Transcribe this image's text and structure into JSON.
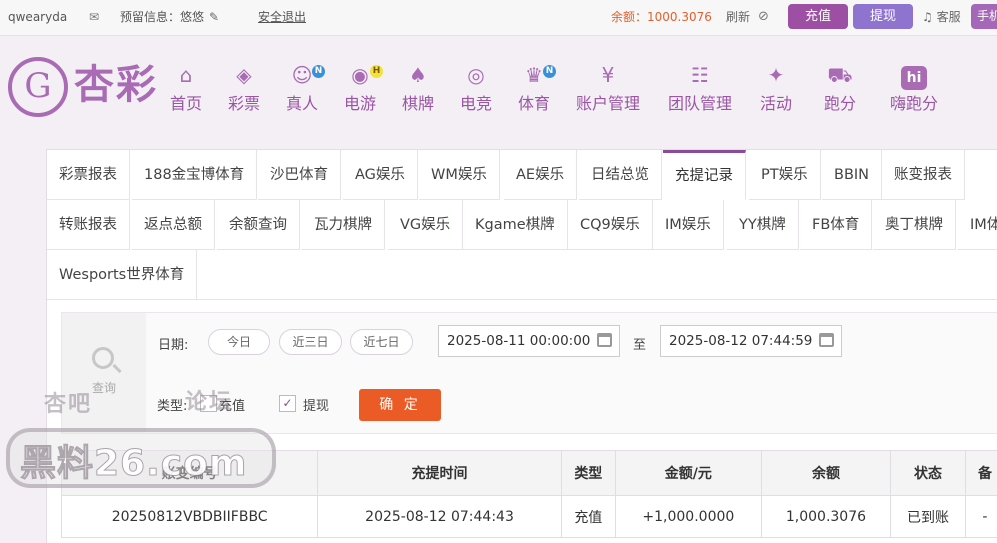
{
  "topbar": {
    "username": "qwearyda",
    "reserved_info": "预留信息：悠悠",
    "logout": "安全退出",
    "balance": "余额：1000.3076",
    "refresh": "刷新",
    "recharge": "充值",
    "withdraw": "提现",
    "service": "客服",
    "mobile": "手机"
  },
  "logo": {
    "mark": "G",
    "text": "杏彩"
  },
  "nav": [
    {
      "label": "首页",
      "icon": "home-icon",
      "glyph": "⌂",
      "badge": ""
    },
    {
      "label": "彩票",
      "icon": "lottery-icon",
      "glyph": "◈",
      "badge": ""
    },
    {
      "label": "真人",
      "icon": "live-dealer-icon",
      "glyph": "☺",
      "badge": "N"
    },
    {
      "label": "电游",
      "icon": "gamepad-icon",
      "glyph": "◉",
      "badge": "H"
    },
    {
      "label": "棋牌",
      "icon": "cards-icon",
      "glyph": "♠",
      "badge": ""
    },
    {
      "label": "电竞",
      "icon": "esports-icon",
      "glyph": "◎",
      "badge": ""
    },
    {
      "label": "体育",
      "icon": "trophy-icon",
      "glyph": "♛",
      "badge": "N"
    },
    {
      "label": "账户管理",
      "icon": "account-icon",
      "glyph": "¥",
      "badge": ""
    },
    {
      "label": "团队管理",
      "icon": "team-icon",
      "glyph": "☷",
      "badge": ""
    },
    {
      "label": "活动",
      "icon": "gift-icon",
      "glyph": "✦",
      "badge": ""
    },
    {
      "label": "跑分",
      "icon": "truck-icon",
      "glyph": "⛟",
      "badge": ""
    },
    {
      "label": "嗨跑分",
      "icon": "hi-icon",
      "glyph": "hi",
      "badge": ""
    }
  ],
  "tabs": [
    "彩票报表",
    "188金宝博体育",
    "沙巴体育",
    "AG娱乐",
    "WM娱乐",
    "AE娱乐",
    "日结总览",
    "充提记录",
    "PT娱乐",
    "BBIN",
    "账变报表",
    "转账报表",
    "返点总额",
    "余额查询",
    "瓦力棋牌",
    "VG娱乐",
    "Kgame棋牌",
    "CQ9娱乐",
    "IM娱乐",
    "YY棋牌",
    "FB体育",
    "奥丁棋牌",
    "IM体",
    "Wesports世界体育"
  ],
  "active_tab": "充提记录",
  "filter": {
    "search_label": "查询",
    "date_label": "日期:",
    "quick": [
      "今日",
      "近三日",
      "近七日"
    ],
    "start": "2025-08-11 00:00:00",
    "to": "至",
    "end": "2025-08-12 07:44:59",
    "type_label": "类型:",
    "types": [
      {
        "label": "充值",
        "checked": false
      },
      {
        "label": "提现",
        "checked": true
      }
    ],
    "confirm": "确 定"
  },
  "table": {
    "headers": [
      "账变编号",
      "充提时间",
      "类型",
      "金额/元",
      "余额",
      "状态",
      "备"
    ],
    "rows": [
      [
        "20250812VBDBIIFBBC",
        "2025-08-12 07:44:43",
        "充值",
        "+1,000.0000",
        "1,000.3076",
        "已到账",
        "-"
      ]
    ]
  },
  "watermark": {
    "line1a": "杏吧",
    "line1b": "论坛",
    "line2": "黑料26.com"
  }
}
